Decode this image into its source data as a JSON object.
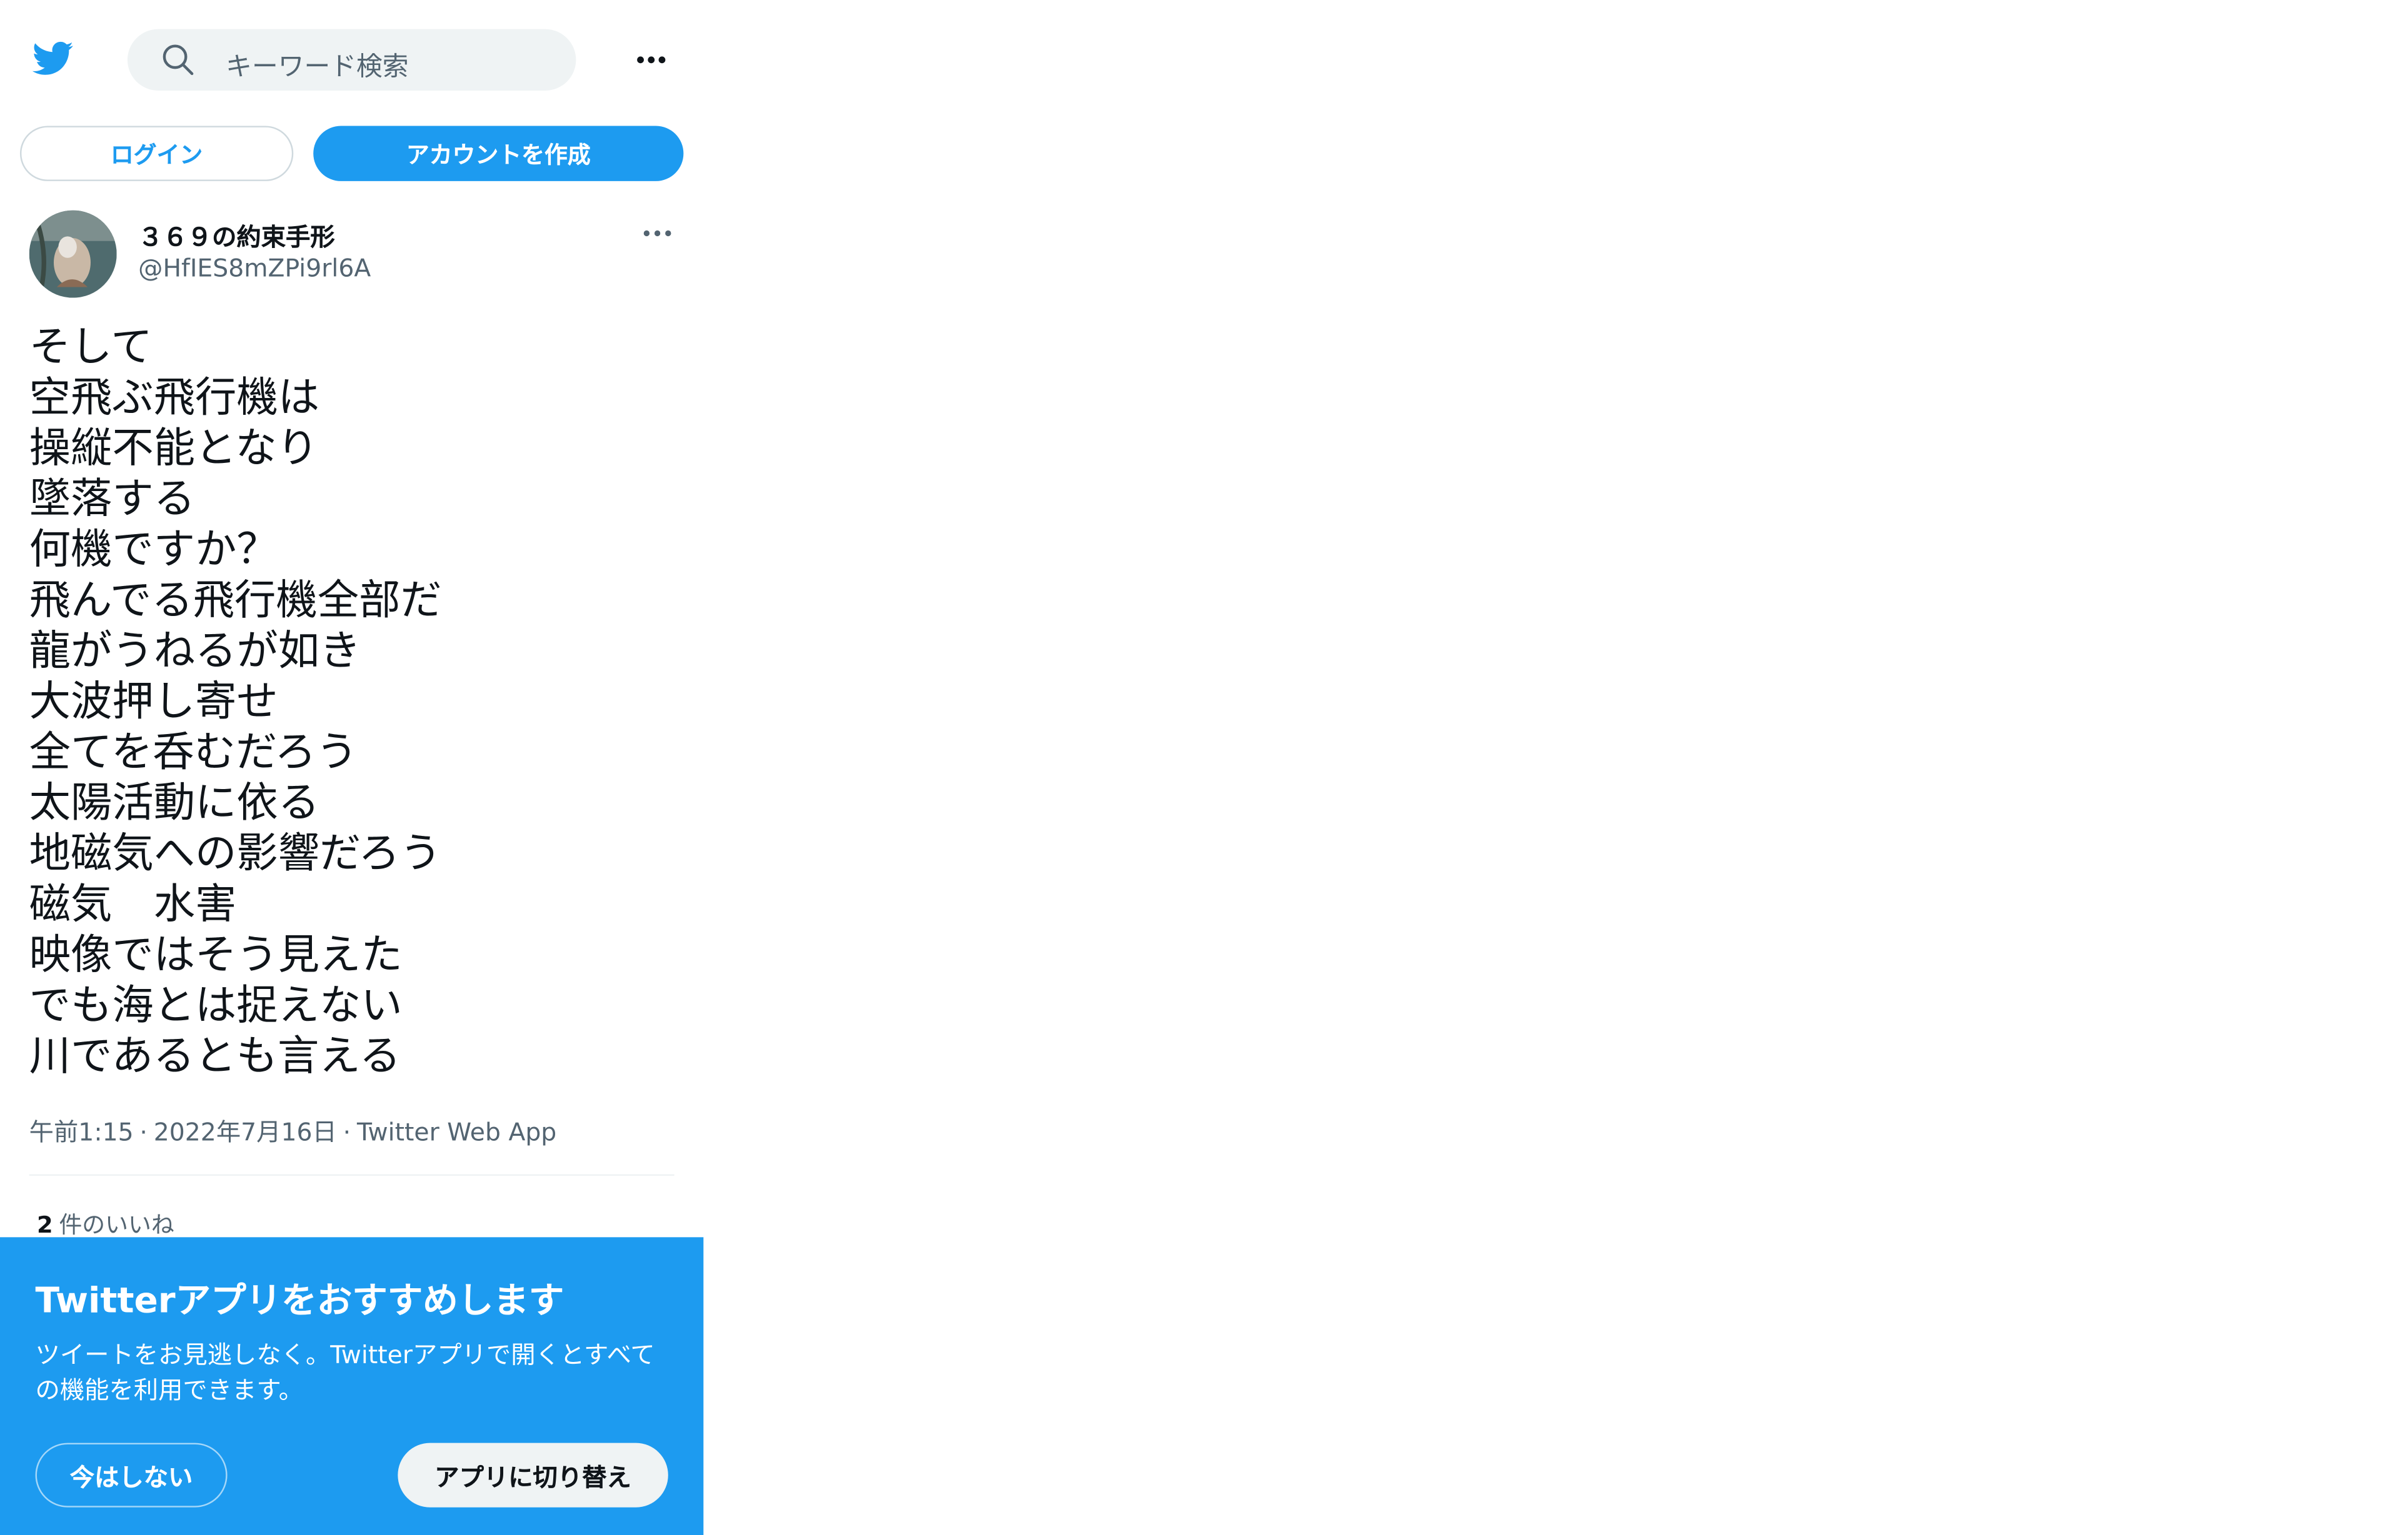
{
  "header": {
    "logo_icon": "twitter-bird-icon",
    "search_placeholder": "キーワード検索",
    "more_icon": "more-dots-icon"
  },
  "auth": {
    "login_label": "ログイン",
    "signup_label": "アカウントを作成"
  },
  "tweet": {
    "author_name": "３６９の約束手形",
    "author_handle": "@HfIES8mZPi9rl6A",
    "lines": [
      "そして",
      "空飛ぶ飛行機は",
      "操縦不能となり",
      "墜落する",
      "何機ですか？",
      "飛んでる飛行機全部だ",
      "龍がうねるが如き",
      "大波押し寄せ",
      "全てを呑むだろう",
      "太陽活動に依る",
      "地磁気への影響だろう",
      "磁気　水害",
      "映像ではそう見えた",
      "でも海とは捉えない",
      "川であるとも言える"
    ],
    "time": "午前1:15",
    "date": "2022年7月16日",
    "source": "Twitter Web App",
    "separator": "·",
    "likes_count": "2",
    "likes_label": "件のいいね"
  },
  "banner": {
    "title": "Twitterアプリをおすすめします",
    "description": "ツイートをお見逃しなく。Twitterアプリで開くとすべての機能を利用できます。",
    "not_now_label": "今はしない",
    "switch_label": "アプリに切り替え"
  },
  "colors": {
    "brand": "#1d9bf0",
    "text": "#0f1419",
    "secondary": "#536471"
  }
}
